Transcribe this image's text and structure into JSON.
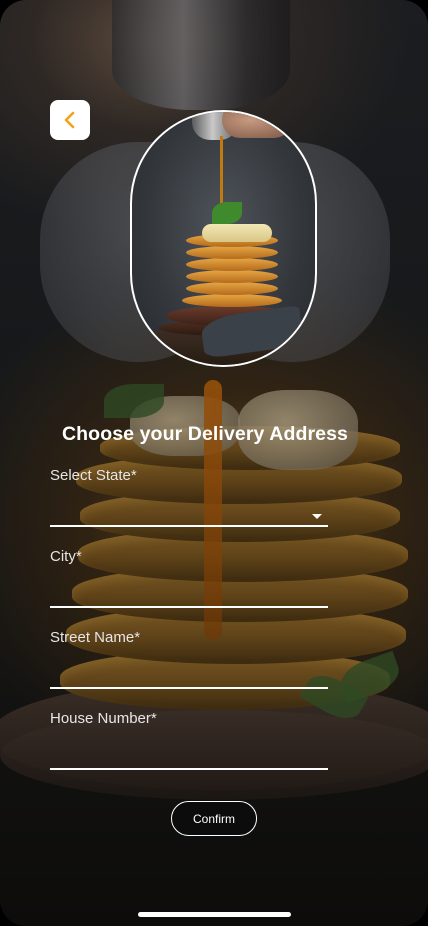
{
  "header": {
    "back_icon": "chevron-left-icon",
    "accent_color": "#F0A21C"
  },
  "page": {
    "title": "Choose your Delivery Address"
  },
  "form": {
    "state": {
      "label": "Select State*",
      "value": "",
      "icon": "caret-down-icon"
    },
    "city": {
      "label": "City*",
      "value": ""
    },
    "street": {
      "label": "Street Name*",
      "value": ""
    },
    "house": {
      "label": "House Number*",
      "value": ""
    }
  },
  "actions": {
    "confirm_label": "Confirm"
  }
}
